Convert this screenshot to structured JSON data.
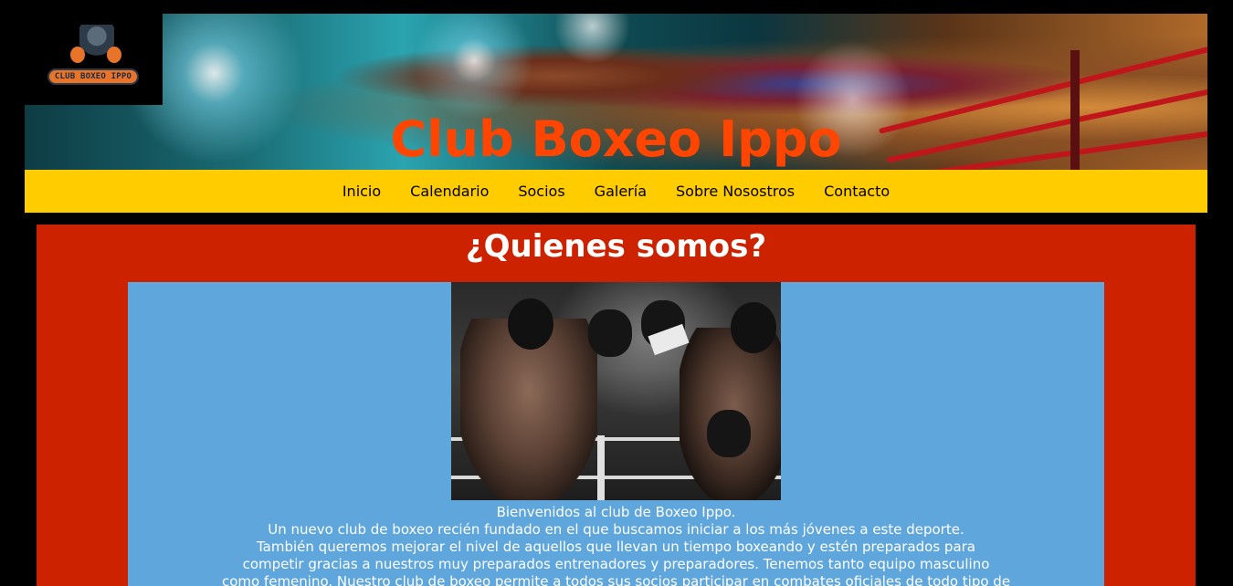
{
  "header": {
    "logo_text": "CLUB BOXEO IPPO",
    "title": "Club Boxeo Ippo"
  },
  "nav": {
    "items": [
      "Inicio",
      "Calendario",
      "Socios",
      "Galería",
      "Sobre Nosostros",
      "Contacto"
    ]
  },
  "main": {
    "heading": "¿Quienes somos?",
    "paragraphs": [
      "Bienvenidos al club de Boxeo Ippo.",
      "Un nuevo club de boxeo recién fundado en el que buscamos iniciar a los más jóvenes a este deporte.",
      "También queremos mejorar el nivel de aquellos que llevan un tiempo boxeando y estén preparados para",
      "competir gracias a nuestros muy preparados entrenadores y preparadores. Tenemos tanto equipo masculino",
      "como femenino. Nuestro club de boxeo permite a todos sus socios participar en combates oficiales de todo tipo de"
    ]
  },
  "colors": {
    "nav_background": "#ffcc00",
    "main_background": "#cc2200",
    "content_background": "#5ea6dc",
    "title_color": "#ff4500"
  }
}
